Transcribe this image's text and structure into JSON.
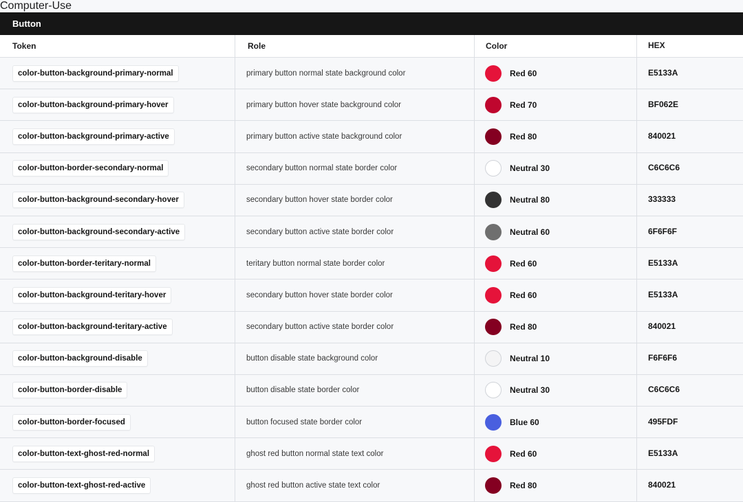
{
  "title": "Button",
  "headers": {
    "token": "Token",
    "role": "Role",
    "color": "Color",
    "hex": "HEX"
  },
  "rows": [
    {
      "token": "color-button-background-primary-normal",
      "role": "primary button normal state background color",
      "color_name": "Red 60",
      "hex": "E5133A",
      "swatch": "#E5133A"
    },
    {
      "token": "color-button-background-primary-hover",
      "role": "primary button hover state background color",
      "color_name": "Red 70",
      "hex": "BF062E",
      "swatch": "#BF062E"
    },
    {
      "token": "color-button-background-primary-active",
      "role": "primary button active state background color",
      "color_name": "Red 80",
      "hex": "840021",
      "swatch": "#840021"
    },
    {
      "token": "color-button-border-secondary-normal",
      "role": "secondary button normal state border color",
      "color_name": "Neutral 30",
      "hex": "C6C6C6",
      "swatch": "#FFFFFF"
    },
    {
      "token": "color-button-background-secondary-hover",
      "role": "secondary button hover state border color",
      "color_name": "Neutral 80",
      "hex": "333333",
      "swatch": "#333333"
    },
    {
      "token": "color-button-background-secondary-active",
      "role": "secondary button active state border color",
      "color_name": "Neutral 60",
      "hex": "6F6F6F",
      "swatch": "#6F6F6F"
    },
    {
      "token": "color-button-border-teritary-normal",
      "role": "teritary button normal state border color",
      "color_name": "Red 60",
      "hex": "E5133A",
      "swatch": "#E5133A"
    },
    {
      "token": "color-button-background-teritary-hover",
      "role": "secondary button hover state border color",
      "color_name": "Red 60",
      "hex": "E5133A",
      "swatch": "#E5133A"
    },
    {
      "token": "color-button-background-teritary-active",
      "role": "secondary button active state border color",
      "color_name": "Red 80",
      "hex": "840021",
      "swatch": "#840021"
    },
    {
      "token": "color-button-background-disable",
      "role": "button disable state background color",
      "color_name": "Neutral 10",
      "hex": "F6F6F6",
      "swatch": "#F4F4F5"
    },
    {
      "token": "color-button-border-disable",
      "role": "button disable state border color",
      "color_name": "Neutral 30",
      "hex": "C6C6C6",
      "swatch": "#FFFFFF"
    },
    {
      "token": "color-button-border-focused",
      "role": "button focused state border color",
      "color_name": "Blue 60",
      "hex": "495FDF",
      "swatch": "#495FDF"
    },
    {
      "token": "color-button-text-ghost-red-normal",
      "role": "ghost red button normal state text color",
      "color_name": "Red 60",
      "hex": "E5133A",
      "swatch": "#E5133A"
    },
    {
      "token": "color-button-text-ghost-red-active",
      "role": "ghost red button active state text color",
      "color_name": "Red 80",
      "hex": "840021",
      "swatch": "#840021"
    }
  ]
}
